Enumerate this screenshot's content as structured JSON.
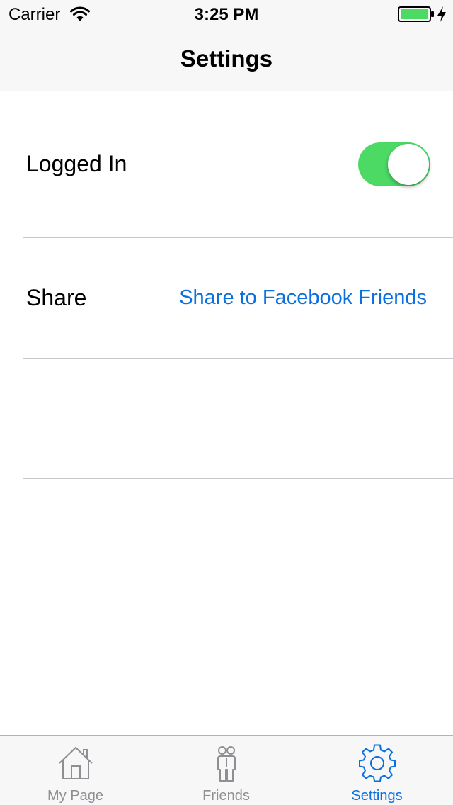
{
  "status_bar": {
    "carrier": "Carrier",
    "time": "3:25 PM",
    "icons": [
      "wifi-icon",
      "battery-icon",
      "charging-bolt-icon"
    ],
    "battery_color": "#4cd964"
  },
  "nav": {
    "title": "Settings"
  },
  "rows": [
    {
      "label": "Logged In",
      "control": "toggle",
      "toggle_on": true,
      "toggle_color": "#4cd964"
    },
    {
      "label": "Share",
      "link_text": "Share to Facebook Friends",
      "link_color": "#0a6fe0"
    }
  ],
  "tab_bar": {
    "items": [
      {
        "label": "My Page",
        "icon": "home-icon",
        "active": false
      },
      {
        "label": "Friends",
        "icon": "friends-icon",
        "active": false
      },
      {
        "label": "Settings",
        "icon": "gear-icon",
        "active": true
      }
    ],
    "active_color": "#0a6fe0",
    "inactive_color": "#8e8e93"
  }
}
